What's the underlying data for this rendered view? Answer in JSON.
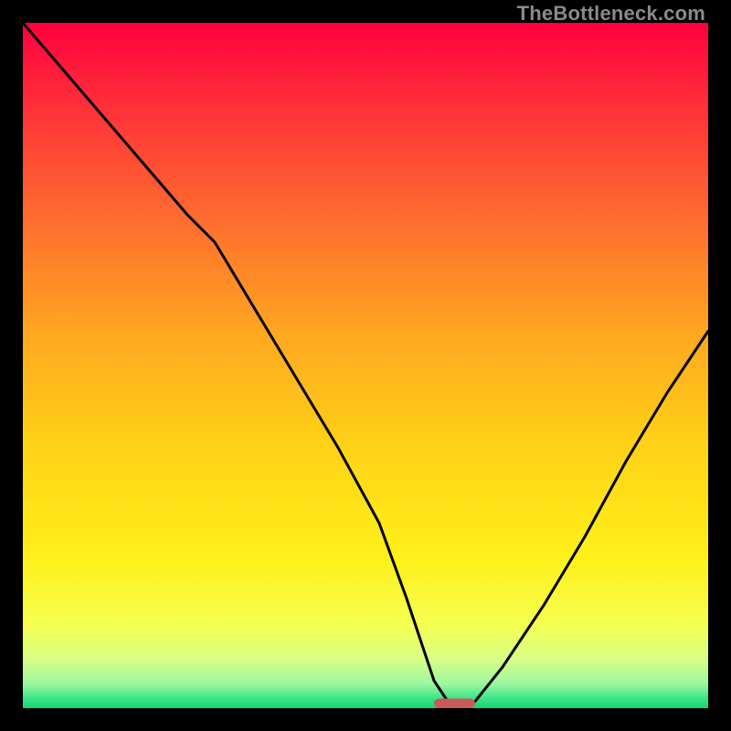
{
  "watermark": "TheBottleneck.com",
  "chart_data": {
    "type": "line",
    "title": "",
    "xlabel": "",
    "ylabel": "",
    "xlim": [
      0,
      100
    ],
    "ylim": [
      0,
      100
    ],
    "grid": false,
    "series": [
      {
        "name": "bottleneck-curve",
        "x": [
          0,
          6,
          12,
          18,
          24,
          28,
          34,
          40,
          46,
          52,
          56,
          58,
          60,
          62,
          64,
          66,
          70,
          76,
          82,
          88,
          94,
          100
        ],
        "y": [
          100,
          93,
          86,
          79,
          72,
          68,
          58,
          48,
          38,
          27,
          16,
          10,
          4,
          1,
          0,
          1,
          6,
          15,
          25,
          36,
          46,
          55
        ]
      }
    ],
    "marker": {
      "x": 63,
      "y": 0,
      "width": 6,
      "height": 1.4
    },
    "background_gradient": {
      "stops": [
        {
          "pos": 0.0,
          "color": "#ff003e"
        },
        {
          "pos": 0.12,
          "color": "#ff2f3a"
        },
        {
          "pos": 0.28,
          "color": "#ff6a2f"
        },
        {
          "pos": 0.45,
          "color": "#ffa621"
        },
        {
          "pos": 0.62,
          "color": "#ffd317"
        },
        {
          "pos": 0.78,
          "color": "#fff01a"
        },
        {
          "pos": 0.88,
          "color": "#f5ff52"
        },
        {
          "pos": 0.93,
          "color": "#d7ff8a"
        },
        {
          "pos": 0.965,
          "color": "#9cf6a0"
        },
        {
          "pos": 0.985,
          "color": "#3fe58a"
        },
        {
          "pos": 1.0,
          "color": "#14d46e"
        }
      ]
    }
  }
}
